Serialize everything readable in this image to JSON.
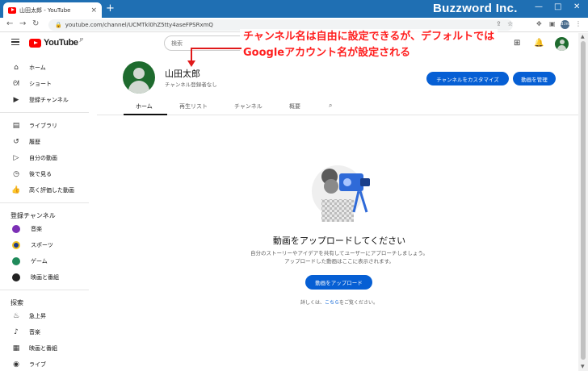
{
  "browser": {
    "tab_title": "山田太郎 - YouTube",
    "tab_close": "×",
    "new_tab": "+",
    "url": "youtube.com/channel/UCMTkl0hZ5tty4aseFPSRxmQ",
    "win_min": "—",
    "win_max": "□",
    "win_close": "✕",
    "profile_initials": "B.Inc"
  },
  "brand": "Buzzword Inc.",
  "youtube": {
    "logo_text": "YouTube",
    "logo_region": "JP",
    "search_placeholder": "検索"
  },
  "annotation": {
    "line1": "チャンネル名は自由に設定できるが、デフォルトでは",
    "line2": "Googleアカウント名が設定される",
    "color": "#ff1f1f"
  },
  "sidebar": {
    "main": [
      {
        "label": "ホーム",
        "icon": "home-icon"
      },
      {
        "label": "ショート",
        "icon": "shorts-icon"
      },
      {
        "label": "登録チャンネル",
        "icon": "subscriptions-icon"
      }
    ],
    "library": [
      {
        "label": "ライブラリ",
        "icon": "library-icon"
      },
      {
        "label": "履歴",
        "icon": "history-icon"
      },
      {
        "label": "自分の動画",
        "icon": "your-videos-icon"
      },
      {
        "label": "後で見る",
        "icon": "watch-later-icon"
      },
      {
        "label": "高く評価した動画",
        "icon": "liked-icon"
      }
    ],
    "subs_heading": "登録チャンネル",
    "subs": [
      {
        "label": "音楽",
        "color": "#7b2fb5"
      },
      {
        "label": "スポーツ",
        "color": "#1e3a8a"
      },
      {
        "label": "ゲーム",
        "color": "#1f8a5a"
      },
      {
        "label": "映画と番組",
        "color": "#222222"
      }
    ],
    "explore_heading": "探索",
    "explore": [
      {
        "label": "急上昇",
        "icon": "trending-icon"
      },
      {
        "label": "音楽",
        "icon": "music-icon"
      },
      {
        "label": "映画と番組",
        "icon": "movies-icon"
      },
      {
        "label": "ライブ",
        "icon": "live-icon"
      }
    ]
  },
  "channel": {
    "name": "山田太郎",
    "subscribers": "チャンネル登録者なし",
    "customize_button": "チャンネルをカスタマイズ",
    "manage_button": "動画を管理",
    "tabs": [
      "ホーム",
      "再生リスト",
      "チャンネル",
      "概要"
    ]
  },
  "empty_state": {
    "title": "動画をアップロードしてください",
    "desc1": "自分のストーリーやアイデアを共有してユーザーにアプローチしましょう。",
    "desc2": "アップロードした動画はここに表示されます。",
    "upload_button": "動画をアップロード",
    "help_prefix": "詳しくは、",
    "help_link": "こちら",
    "help_suffix": "をご覧ください。"
  }
}
